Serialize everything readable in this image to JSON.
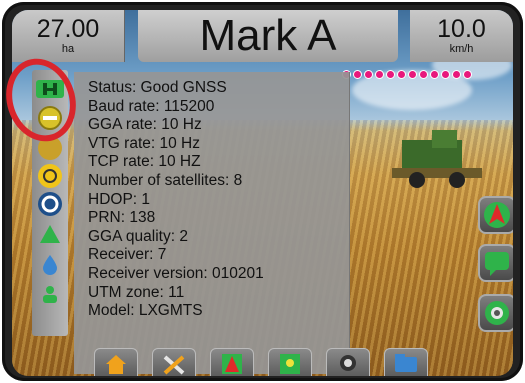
{
  "header": {
    "area_value": "27.00",
    "area_unit": "ha",
    "title": "Mark A",
    "speed_value": "10.0",
    "speed_unit": "km/h"
  },
  "gnss_panel": {
    "lines": [
      "Status: Good GNSS",
      "Baud rate: 115200",
      "GGA rate: 10 Hz",
      "VTG rate: 10 Hz",
      "TCP rate: 10 HZ",
      "Number of satellites: 8",
      "HDOP: 1",
      "PRN: 138",
      "GGA quality: 2",
      "Receiver: 7",
      "Receiver version: 010201",
      "UTM zone: 11",
      "Model: LXGMTS"
    ]
  },
  "sidebar": {
    "icons": [
      "gnss-status-icon",
      "minus-tab-icon",
      "boom-icon",
      "warning-icon",
      "steering-icon",
      "guidance-icon",
      "liquid-icon",
      "person-icon"
    ]
  },
  "right_buttons": [
    "orientation-icon",
    "message-icon",
    "camera-view-icon"
  ],
  "bottom_nav": [
    "home-icon",
    "tools-icon",
    "guidance-nav-icon",
    "map-nav-icon",
    "camera-icon",
    "folder-icon"
  ],
  "colors": {
    "led": "#e8187c",
    "highlight_ring": "#d9262c",
    "gnss_green": "#2fb34a"
  }
}
